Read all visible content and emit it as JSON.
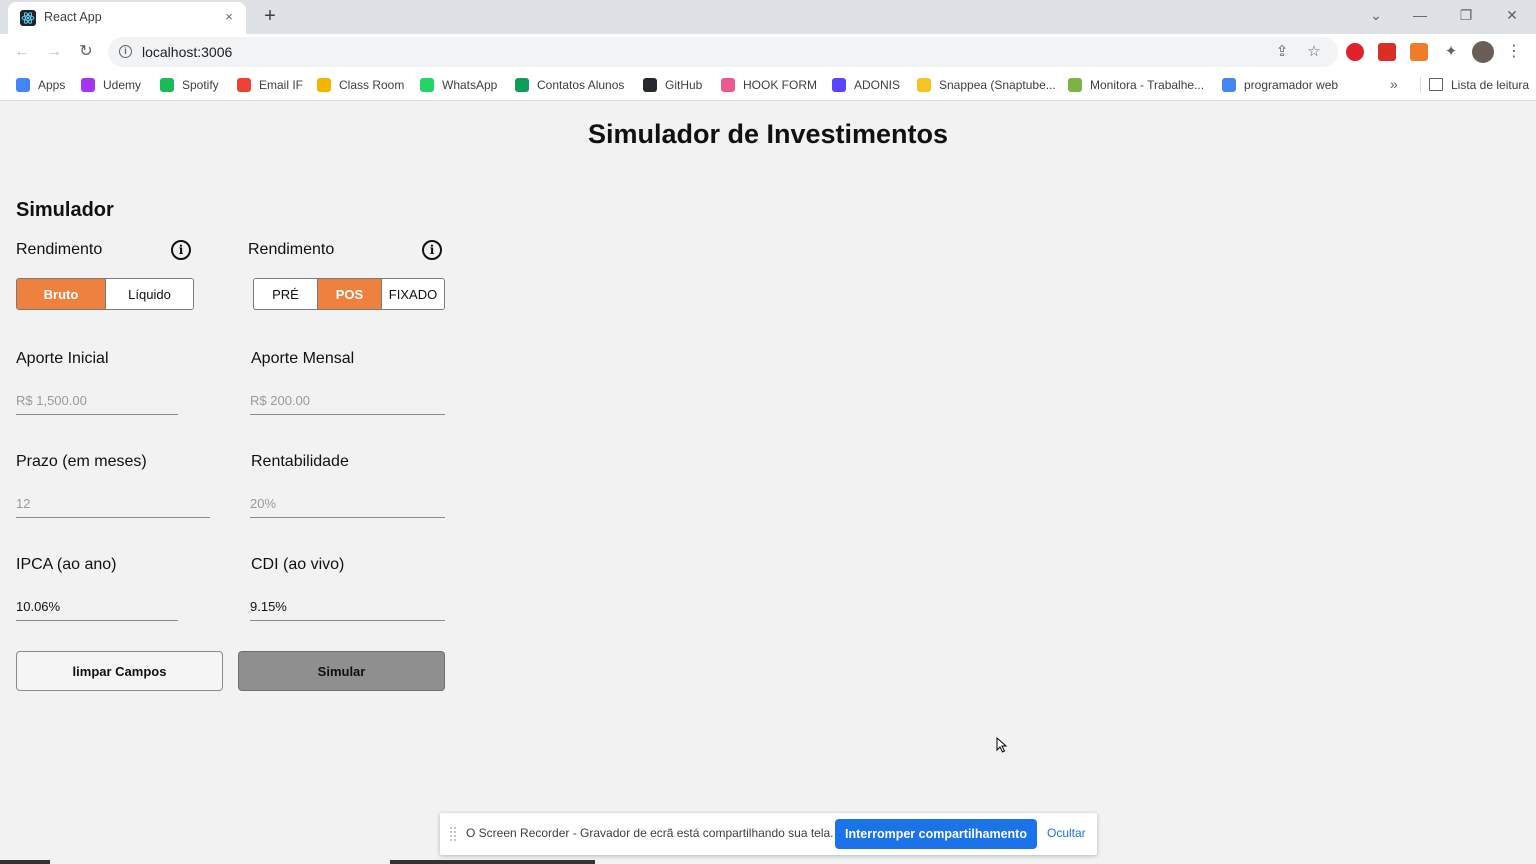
{
  "browser": {
    "tab_title": "React App",
    "tab_close": "×",
    "new_tab": "+",
    "url": "localhost:3006",
    "reading_list": "Lista de leitura",
    "bookmarks_more": "»",
    "bookmarks": [
      {
        "label": "Apps",
        "icon": "apps-icon",
        "color": "#4285f4"
      },
      {
        "label": "Udemy",
        "icon": "udemy-icon",
        "color": "#a435f0"
      },
      {
        "label": "Spotify",
        "icon": "spotify-icon",
        "color": "#1db954"
      },
      {
        "label": "Email IF",
        "icon": "gmail-icon",
        "color": "#ea4335"
      },
      {
        "label": "Class Room",
        "icon": "classroom-icon",
        "color": "#f4b400"
      },
      {
        "label": "WhatsApp",
        "icon": "whatsapp-icon",
        "color": "#25d366"
      },
      {
        "label": "Contatos Alunos",
        "icon": "sheets-icon",
        "color": "#0f9d58"
      },
      {
        "label": "GitHub",
        "icon": "github-icon",
        "color": "#24292e"
      },
      {
        "label": "HOOK FORM",
        "icon": "hookform-icon",
        "color": "#ec5990"
      },
      {
        "label": "ADONIS",
        "icon": "adonis-icon",
        "color": "#5a45ff"
      },
      {
        "label": "Snappea (Snaptube...",
        "icon": "snappea-icon",
        "color": "#f7c325"
      },
      {
        "label": "Monitora - Trabalhe...",
        "icon": "monitora-icon",
        "color": "#7cb342"
      },
      {
        "label": "programador web",
        "icon": "google-icon",
        "color": "#4285f4"
      }
    ]
  },
  "page": {
    "title": "Simulador de Investimentos",
    "section_title": "Simulador",
    "rendimento_label_1": "Rendimento",
    "rendimento_label_2": "Rendimento",
    "info_glyph": "i",
    "rendimento_options": [
      {
        "label": "Bruto",
        "active": true
      },
      {
        "label": "Líquido",
        "active": false
      }
    ],
    "indexacao_options": [
      {
        "label": "PRÉ",
        "active": false
      },
      {
        "label": "POS",
        "active": true
      },
      {
        "label": "FIXADO",
        "active": false
      }
    ],
    "aporte_inicial": {
      "label": "Aporte Inicial",
      "placeholder": "R$ 1,500.00"
    },
    "aporte_mensal": {
      "label": "Aporte Mensal",
      "placeholder": "R$ 200.00"
    },
    "prazo": {
      "label": "Prazo (em meses)",
      "placeholder": "12"
    },
    "rentabilidade": {
      "label": "Rentabilidade",
      "placeholder": "20%"
    },
    "ipca": {
      "label": "IPCA (ao ano)",
      "value": "10.06%"
    },
    "cdi": {
      "label": "CDI (ao vivo)",
      "value": "9.15%"
    },
    "clear_button": "limpar Campos",
    "simulate_button": "Simular",
    "accent_color": "#ee8140"
  },
  "share_bar": {
    "message": "O Screen Recorder - Gravador de ecrã está compartilhando sua tela.",
    "stop_label": "Interromper compartilhamento",
    "hide_label": "Ocultar"
  }
}
